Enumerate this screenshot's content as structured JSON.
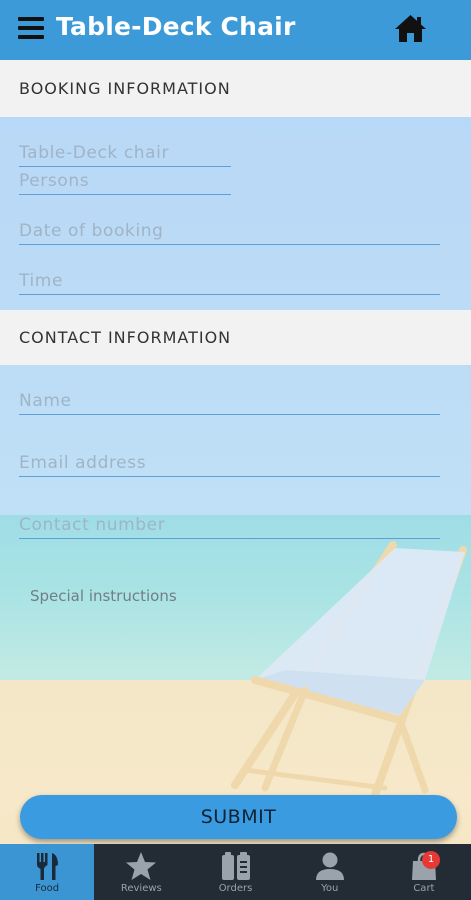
{
  "header": {
    "title": "Table-Deck Chair"
  },
  "sections": {
    "booking": "BOOKING INFORMATION",
    "contact": "CONTACT INFORMATION"
  },
  "fields": {
    "table_deck_chair": {
      "placeholder": "Table-Deck chair",
      "value": ""
    },
    "persons": {
      "placeholder": "Persons",
      "value": ""
    },
    "date_of_booking": {
      "placeholder": "Date of booking",
      "value": ""
    },
    "time": {
      "placeholder": "Time",
      "value": ""
    },
    "name": {
      "placeholder": "Name",
      "value": ""
    },
    "email": {
      "placeholder": "Email address",
      "value": ""
    },
    "contact_number": {
      "placeholder": "Contact number",
      "value": ""
    },
    "special_instructions": {
      "placeholder": "Special instructions",
      "value": ""
    }
  },
  "submit_label": "SUBMIT",
  "nav": [
    {
      "label": "Food",
      "icon": "fork-knife-icon",
      "active": true
    },
    {
      "label": "Reviews",
      "icon": "star-icon",
      "active": false
    },
    {
      "label": "Orders",
      "icon": "orders-icon",
      "active": false
    },
    {
      "label": "You",
      "icon": "user-icon",
      "active": false
    },
    {
      "label": "Cart",
      "icon": "shopping-bag-icon",
      "active": false
    }
  ],
  "cart_badge": "1",
  "icons": {
    "menu": "hamburger-menu-icon",
    "home": "home-icon"
  },
  "colors": {
    "header": "#3d9ad8",
    "accent": "#3a9be0",
    "nav_background": "#232b34",
    "nav_active": "#3b95d3",
    "badge": "#e53935"
  }
}
